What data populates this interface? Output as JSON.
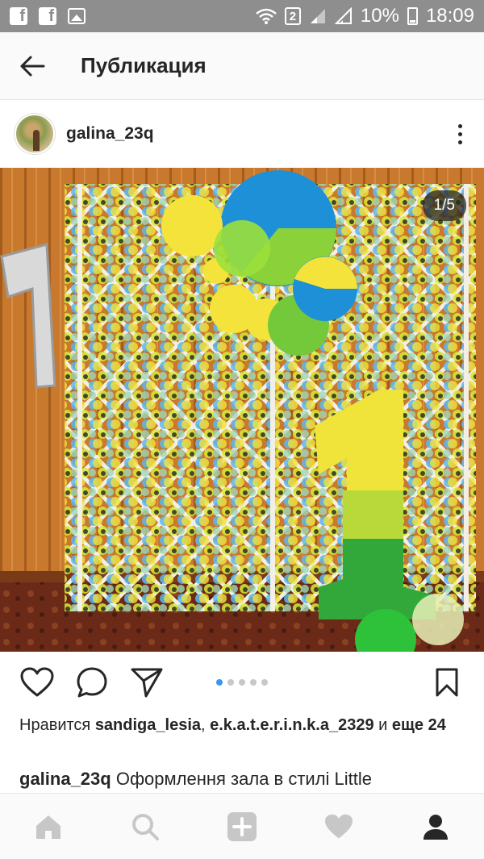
{
  "status_bar": {
    "icons": [
      "facebook-icon",
      "facebook-icon",
      "image-icon",
      "wifi-icon",
      "sim-2-icon",
      "signal-icon",
      "signal-icon",
      "battery-icon"
    ],
    "sim_label": "2",
    "battery": "10%",
    "time": "18:09"
  },
  "header": {
    "back_icon": "arrow-left-icon",
    "title": "Публикация"
  },
  "post": {
    "username": "galina_23q",
    "more_icon": "more-vertical-icon",
    "image_counter": "1/5",
    "carousel": {
      "count": 5,
      "active_index": 0
    }
  },
  "actions": {
    "like_icon": "heart-icon",
    "comment_icon": "comment-icon",
    "share_icon": "send-icon",
    "save_icon": "bookmark-icon"
  },
  "likes": {
    "prefix": "Нравится ",
    "user1": "sandiga_lesia",
    "separator": ", ",
    "user2": "e.k.a.t.e.r.i.n.k.a_2329",
    "middle": " и ",
    "others": "еще 24"
  },
  "caption": {
    "username": "galina_23q",
    "text": " Оформлення зала в стилі Little"
  },
  "bottom_nav": [
    "home-icon",
    "search-icon",
    "add-icon",
    "heart-icon",
    "profile-icon"
  ],
  "colors": {
    "accent": "#3897f0",
    "text": "#262626",
    "status_bar": "#8e8e8e",
    "inactive_icon": "#c7c7c7"
  }
}
